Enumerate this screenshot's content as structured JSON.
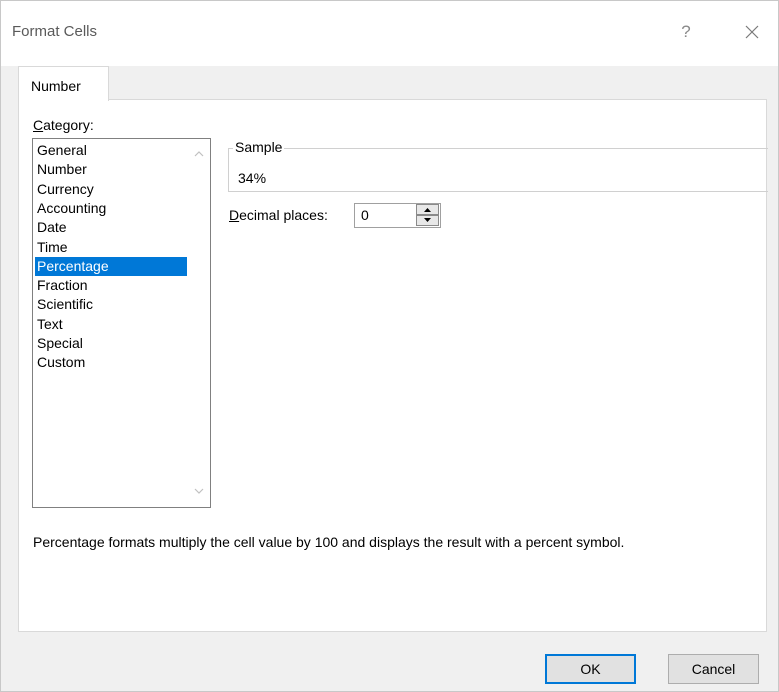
{
  "dialog": {
    "title": "Format Cells",
    "help": "?"
  },
  "tabs": [
    {
      "label": "Number"
    }
  ],
  "category": {
    "label_prefix": "C",
    "label_rest": "ategory:",
    "items": [
      "General",
      "Number",
      "Currency",
      "Accounting",
      "Date",
      "Time",
      "Percentage",
      "Fraction",
      "Scientific",
      "Text",
      "Special",
      "Custom"
    ],
    "selected": "Percentage"
  },
  "sample": {
    "legend": "Sample",
    "value": "34%"
  },
  "decimal_places": {
    "label_prefix": "D",
    "label_rest": "ecimal places:",
    "value": "0"
  },
  "description": "Percentage formats multiply the cell value by 100 and displays the result with a percent symbol.",
  "buttons": {
    "ok": "OK",
    "cancel": "Cancel"
  },
  "colors": {
    "selection": "#0078d7",
    "dialog_bg": "#f0f0f0",
    "panel_bg": "#ffffff"
  },
  "icons": {
    "close": "close-icon",
    "scroll_up": "chevron-up-icon",
    "scroll_down": "chevron-down-icon",
    "spin_up": "spin-up-icon",
    "spin_down": "spin-down-icon"
  }
}
